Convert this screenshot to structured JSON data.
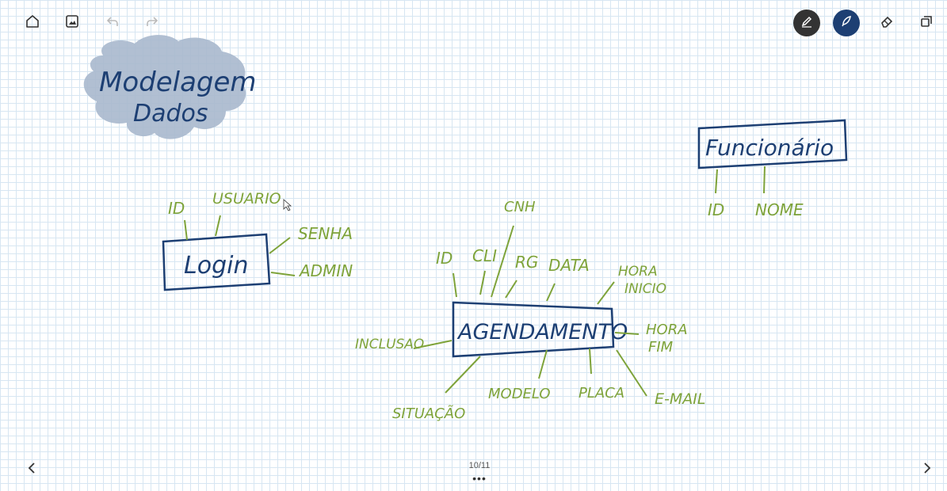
{
  "colors": {
    "green": "#7ea33a",
    "blue": "#1d3f73",
    "cloud": "#a9b8cd",
    "pen_dark": "#333333",
    "pen_blue": "#1d3f73"
  },
  "toolbar": {
    "home": "home-icon",
    "image": "image-icon",
    "undo": "undo-icon",
    "redo": "redo-icon",
    "pen": "pen-icon",
    "highlighter": "highlighter-icon",
    "eraser": "eraser-icon",
    "lasso": "lasso-icon"
  },
  "canvas": {
    "title": [
      "Modelagem",
      "Dados"
    ],
    "login": {
      "box": "Login",
      "attributes": [
        "ID",
        "USUARIO",
        "SENHA",
        "ADMIN"
      ]
    },
    "funcionario": {
      "box": "Funcionário",
      "attributes": [
        "ID",
        "NOME"
      ]
    },
    "agendamento": {
      "box": "AGENDAMENTO",
      "attributes": [
        "CNH",
        "ID",
        "CLI",
        "RG",
        "DATA",
        "HORA",
        "INICIO",
        "HORA",
        "FIM",
        "INCLUSAO",
        "SITUAÇÃO",
        "MODELO",
        "PLACA",
        "E-MAIL"
      ]
    }
  },
  "nav": {
    "page": "10/11",
    "more": "•••",
    "prev": "chevron-left-icon",
    "next": "chevron-right-icon"
  }
}
